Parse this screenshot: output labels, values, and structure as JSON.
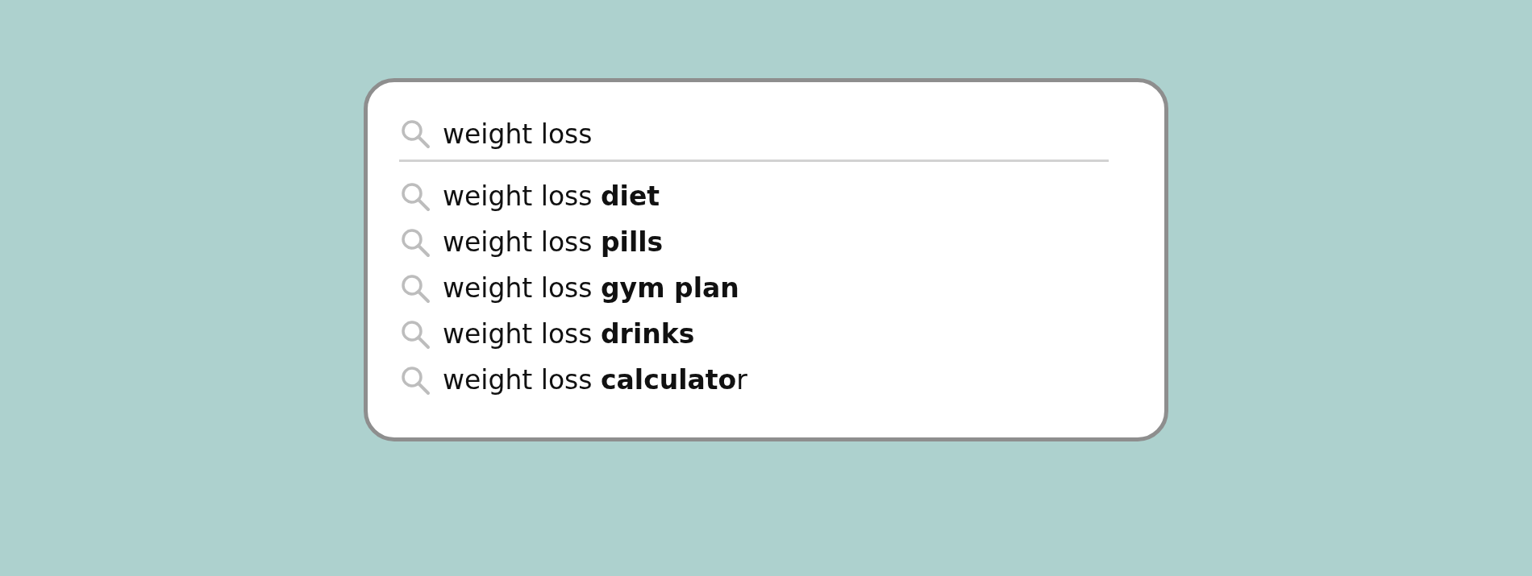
{
  "search": {
    "value": "weight loss"
  },
  "suggestions": [
    {
      "text": "weight loss **diet**"
    },
    {
      "text": "weight loss **pills**"
    },
    {
      "text": "weight loss **gym plan**"
    },
    {
      "text": "weight loss **drinks**"
    },
    {
      "text": "weight loss **calculato**r"
    }
  ]
}
